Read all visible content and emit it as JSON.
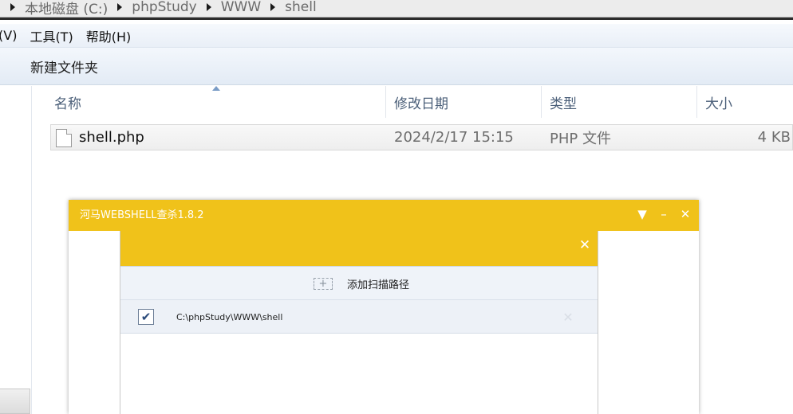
{
  "breadcrumb": {
    "items": [
      "本地磁盘 (C:)",
      "phpStudy",
      "WWW",
      "shell"
    ]
  },
  "menubar": {
    "items": [
      "(V)",
      "工具(T)",
      "帮助(H)"
    ]
  },
  "commandbar": {
    "new_folder": "新建文件夹"
  },
  "columns": {
    "name": "名称",
    "date": "修改日期",
    "type": "类型",
    "size": "大小"
  },
  "files": [
    {
      "name": "shell.php",
      "date": "2024/2/17 15:15",
      "type": "PHP 文件",
      "size": "4 KB"
    }
  ],
  "webshell_window": {
    "title": "河马WEBSHELL查杀1.8.2",
    "menu_icon": "▼",
    "minimize_icon": "–",
    "close_icon": "✕",
    "accent_color": "#f0c21a",
    "dialog": {
      "close_icon": "✕",
      "add_path_icon": "+",
      "add_path_label": "添加扫描路径",
      "paths": [
        {
          "checked": true,
          "check_glyph": "✔",
          "path": "C:\\phpStudy\\WWW\\shell",
          "remove_icon": "✕"
        }
      ]
    }
  }
}
